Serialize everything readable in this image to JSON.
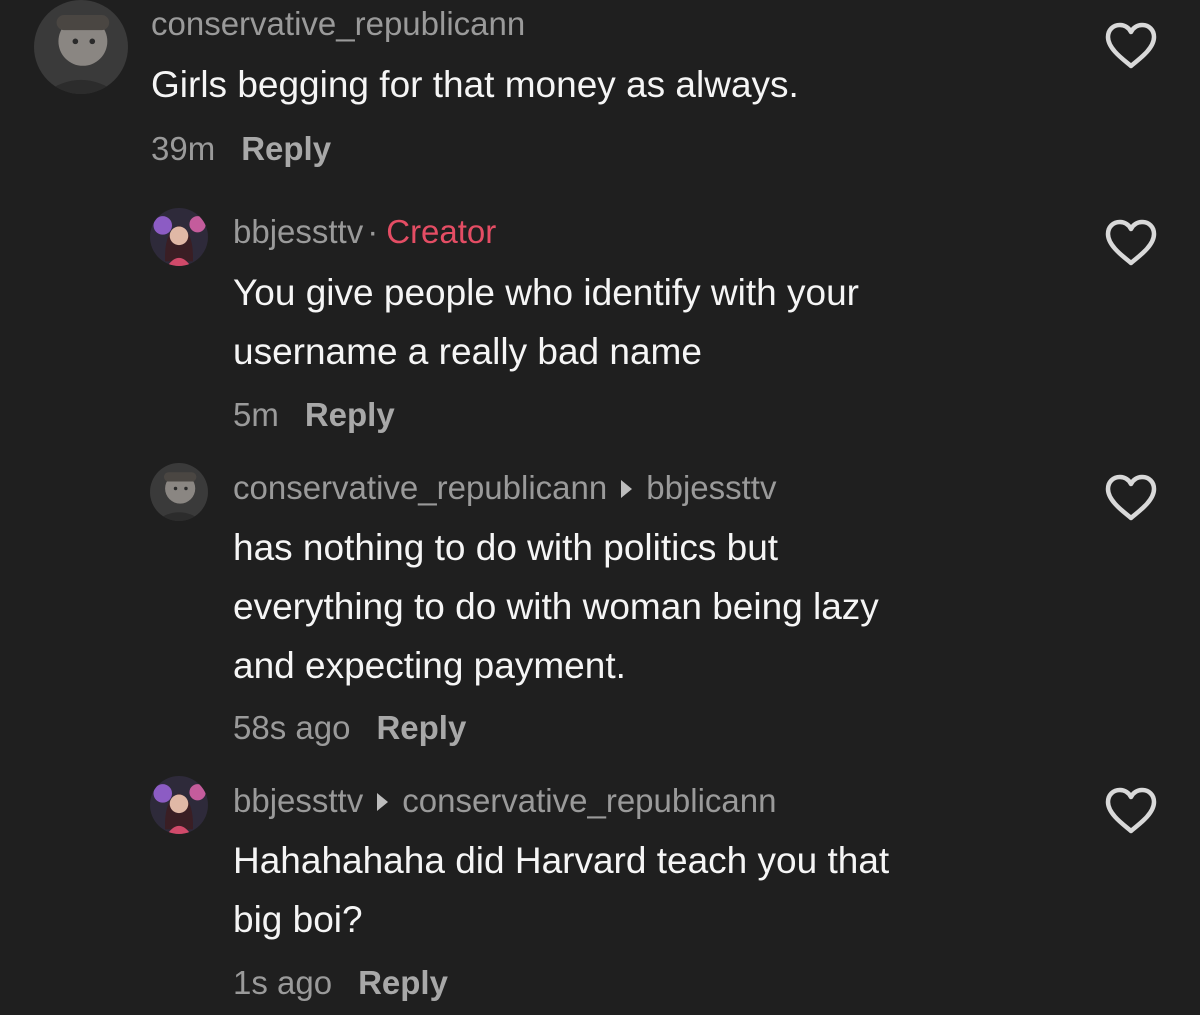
{
  "comments": [
    {
      "author": "conservative_republicann",
      "text": "Girls begging for that money as always.",
      "time": "39m",
      "reply_label": "Reply",
      "avatar_icon": "user-avatar-man",
      "like_icon": "heart-outline-icon"
    },
    {
      "author": "bbjessttv",
      "badge_separator": "·",
      "badge": "Creator",
      "text": "You give people who identify with your\nusername a really bad name",
      "time": "5m",
      "reply_label": "Reply",
      "avatar_icon": "user-avatar-woman",
      "like_icon": "heart-outline-icon"
    },
    {
      "author": "conservative_republicann",
      "reply_to": "bbjessttv",
      "text": "has nothing to do with politics but\neverything to do with woman being lazy\nand expecting payment.",
      "time": "58s ago",
      "reply_label": "Reply",
      "avatar_icon": "user-avatar-man",
      "like_icon": "heart-outline-icon"
    },
    {
      "author": "bbjessttv",
      "reply_to": "conservative_republicann",
      "text": "Hahahahaha did Harvard teach you that\nbig boi?",
      "time": "1s ago",
      "reply_label": "Reply",
      "avatar_icon": "user-avatar-woman",
      "like_icon": "heart-outline-icon"
    }
  ],
  "colors": {
    "background": "#1f1f1f",
    "muted_text": "#9a9a9a",
    "creator_badge": "#e44d64",
    "body_text": "#f5f5f5"
  }
}
